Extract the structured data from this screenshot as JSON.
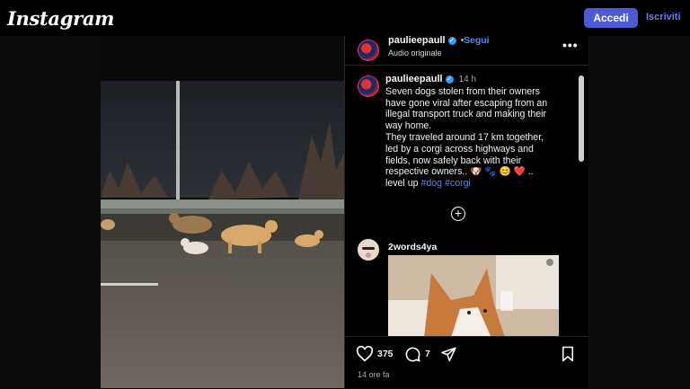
{
  "header": {
    "logo": "Instagram",
    "login_label": "Accedi",
    "signup_label": "Iscriviti"
  },
  "post": {
    "username": "paulieepaull",
    "follow_label": "Segui",
    "audio_label": "Audio originale",
    "time_posted": "14 h",
    "caption_lines": [
      "Seven dogs stolen from their owners",
      "have gone viral after escaping from an",
      "illegal transport truck and making their",
      "way home.",
      "They traveled around 17 km together,",
      "led by a corgi across highways and",
      "fields, now safely back with their",
      "respective owners.. 🐶 🐾 😊 ❤️ ..",
      "level up"
    ],
    "hashtags": [
      "#dog",
      "#corgi"
    ],
    "likes": "375",
    "comments": "7",
    "posted_ago": "14 ore fa"
  },
  "comment": {
    "username": "2words4ya"
  },
  "icons": {
    "verified": "verified-badge-icon",
    "more": "more-options-icon",
    "add_comment": "plus-circle-icon",
    "like": "heart-icon",
    "comment": "comment-bubble-icon",
    "share": "paper-plane-icon",
    "save": "bookmark-icon"
  },
  "colors": {
    "brand_button": "#4f5bd5",
    "link_blue": "#4f8df7",
    "verified": "#3897f0",
    "background": "#000000"
  }
}
